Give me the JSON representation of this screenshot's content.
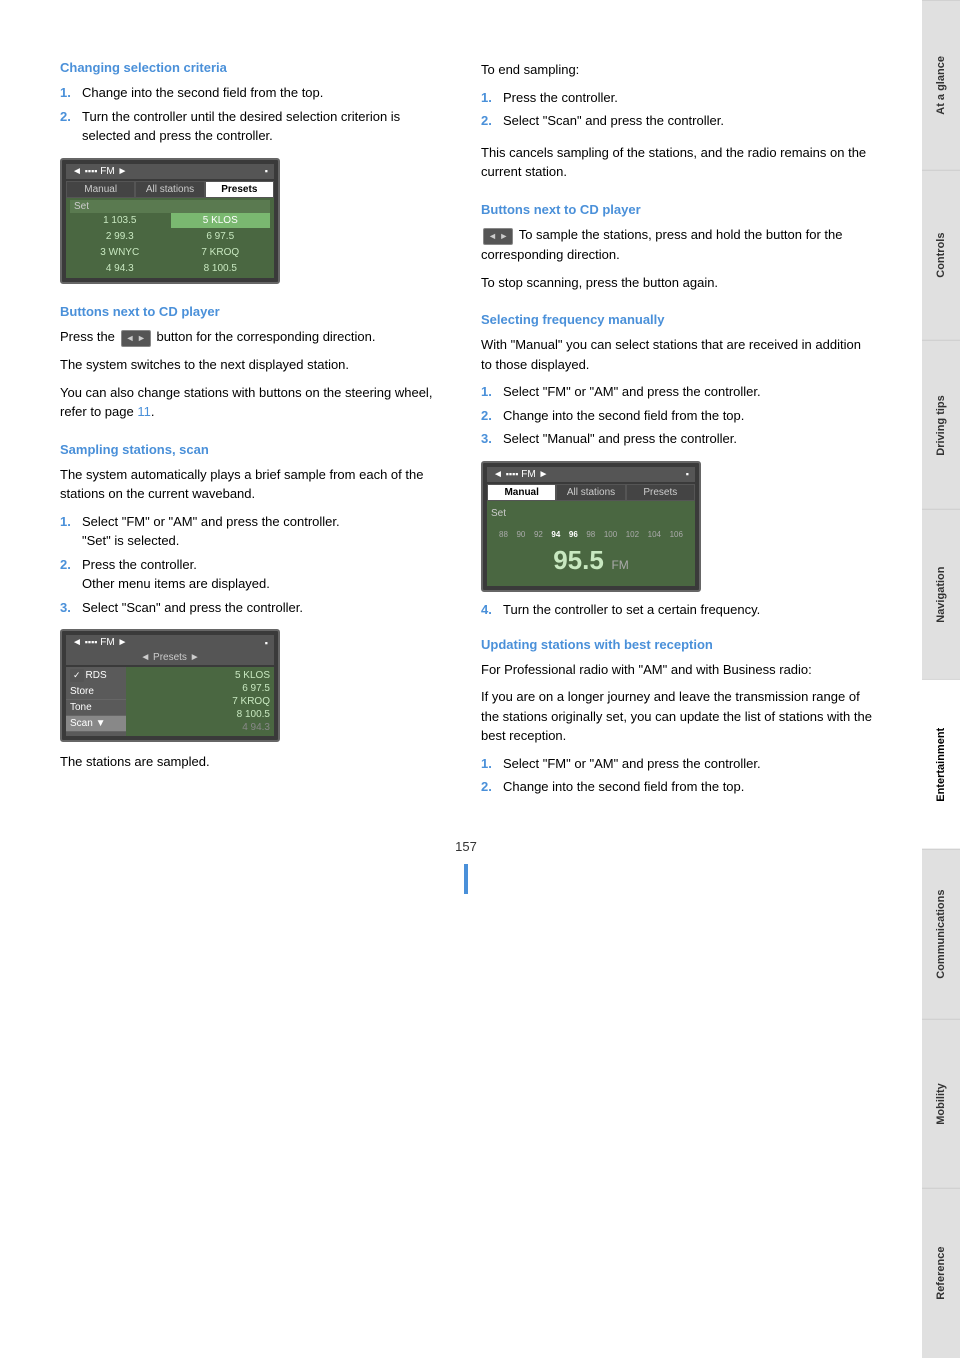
{
  "sidebar": {
    "tabs": [
      {
        "label": "At a glance",
        "active": false
      },
      {
        "label": "Controls",
        "active": false
      },
      {
        "label": "Driving tips",
        "active": false
      },
      {
        "label": "Navigation",
        "active": false
      },
      {
        "label": "Entertainment",
        "active": true
      },
      {
        "label": "Communications",
        "active": false
      },
      {
        "label": "Mobility",
        "active": false
      },
      {
        "label": "Reference",
        "active": false
      }
    ]
  },
  "page_number": "157",
  "left_column": {
    "section1": {
      "heading": "Changing selection criteria",
      "steps": [
        {
          "num": "1.",
          "text": "Change into the second field from the top."
        },
        {
          "num": "2.",
          "text": "Turn the controller until the desired selection criterion is selected and press the controller."
        }
      ]
    },
    "screen1": {
      "top": "◄ ▪▪▪▪▪  FM  ►",
      "tabs": [
        "Manual",
        "All stations",
        "Presets"
      ],
      "active_tab": "Presets",
      "set_label": "Set",
      "stations": [
        {
          "col1": "1  103.5",
          "col2": "5 KLOS"
        },
        {
          "col1": "2  99.3",
          "col2": "6  97.5"
        },
        {
          "col1": "3 WNYC",
          "col2": "7 KROQ"
        },
        {
          "col1": "4  94.3",
          "col2": "8  100.5"
        }
      ]
    },
    "section2": {
      "heading": "Buttons next to CD player",
      "para1": "Press the [◄►] button for the corresponding direction.",
      "para2": "The system switches to the next displayed station.",
      "para3": "You can also change stations with buttons on the steering wheel, refer to page 11."
    },
    "section3": {
      "heading": "Sampling stations, scan",
      "intro": "The system automatically plays a brief sample from each of the stations on the current waveband.",
      "steps": [
        {
          "num": "1.",
          "text": "Select \"FM\" or \"AM\" and press the controller.\n\"Set\" is selected."
        },
        {
          "num": "2.",
          "text": "Press the controller.\nOther menu items are displayed."
        },
        {
          "num": "3.",
          "text": "Select \"Scan\" and press the controller."
        }
      ]
    },
    "screen2": {
      "top": "◄ ▪▪▪▪▪  FM  ►",
      "presets_row": "◄ Presets ►",
      "menu_items": [
        "✓RDS",
        "Store",
        "Tone",
        "Scan"
      ],
      "active_menu": "Scan",
      "stations_right": [
        "5 KLOS",
        "6  97.5",
        "7 KROQ",
        "8  100.5"
      ],
      "bottom_station": "4  94.3"
    },
    "caption": "The stations are sampled."
  },
  "right_column": {
    "sampling_end": {
      "heading": "To end sampling:",
      "steps": [
        {
          "num": "1.",
          "text": "Press the controller."
        },
        {
          "num": "2.",
          "text": "Select \"Scan\" and press the controller."
        }
      ],
      "para1": "This cancels sampling of the stations, and the radio remains on the current station."
    },
    "section_cd": {
      "heading": "Buttons next to CD player",
      "para1": "To sample the stations, press and hold the button for the corresponding direction.",
      "para2": "To stop scanning, press the button again."
    },
    "section_freq": {
      "heading": "Selecting frequency manually",
      "intro": "With \"Manual\" you can select stations that are received in addition to those displayed.",
      "steps": [
        {
          "num": "1.",
          "text": "Select \"FM\" or \"AM\" and press the controller."
        },
        {
          "num": "2.",
          "text": "Change into the second field from the top."
        },
        {
          "num": "3.",
          "text": "Select \"Manual\" and press the controller."
        }
      ]
    },
    "screen3": {
      "top": "◄ ▪▪▪▪▪  FM  ►",
      "tabs": [
        "Manual",
        "All stations",
        "Presets"
      ],
      "active_tab": "Manual",
      "set_label": "Set",
      "freq_numbers": "88 90 92 94 96 98 100 102 104 106",
      "freq_large": "95.5",
      "freq_unit": "FM"
    },
    "step4": {
      "num": "4.",
      "text": "Turn the controller to set a certain frequency."
    },
    "section_update": {
      "heading": "Updating stations with best reception",
      "intro": "For Professional radio with \"AM\" and with Business radio:",
      "para1": "If you are on a longer journey and leave the transmission range of the stations originally set, you can update the list of stations with the best reception.",
      "steps": [
        {
          "num": "1.",
          "text": "Select \"FM\" or \"AM\" and press the controller."
        },
        {
          "num": "2.",
          "text": "Change into the second field from the top."
        }
      ]
    }
  }
}
